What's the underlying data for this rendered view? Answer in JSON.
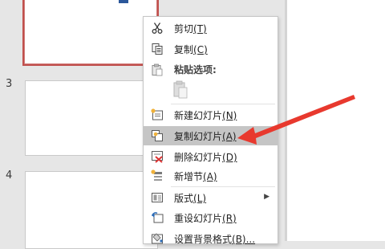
{
  "slide_panel": {
    "slide_numbers": [
      "3",
      "4"
    ]
  },
  "context_menu": {
    "items": [
      {
        "label": "剪切",
        "hotkey": "(T)",
        "icon": "scissors-icon"
      },
      {
        "label": "复制",
        "hotkey": "(C)",
        "icon": "copy-icon"
      },
      {
        "label": "粘贴选项:",
        "icon": "paste-icon"
      },
      {
        "label": "新建幻灯片",
        "hotkey": "(N)",
        "icon": "new-slide-icon"
      },
      {
        "label": "复制幻灯片",
        "hotkey": "(A)",
        "icon": "duplicate-slide-icon",
        "highlighted": true
      },
      {
        "label": "删除幻灯片",
        "hotkey": "(D)",
        "icon": "delete-slide-icon"
      },
      {
        "label": "新增节",
        "hotkey": "(A)",
        "icon": "add-section-icon"
      },
      {
        "label": "版式",
        "hotkey": "(L)",
        "icon": "layout-icon",
        "submenu": true
      },
      {
        "label": "重设幻灯片",
        "hotkey": "(R)",
        "icon": "reset-slide-icon"
      },
      {
        "label": "设置背景格式",
        "hotkey": "(B)...",
        "icon": "format-background-icon"
      }
    ]
  },
  "colors": {
    "selected_border": "#c0504d",
    "highlight": "#c5c5c5",
    "arrow": "#e8392e"
  }
}
